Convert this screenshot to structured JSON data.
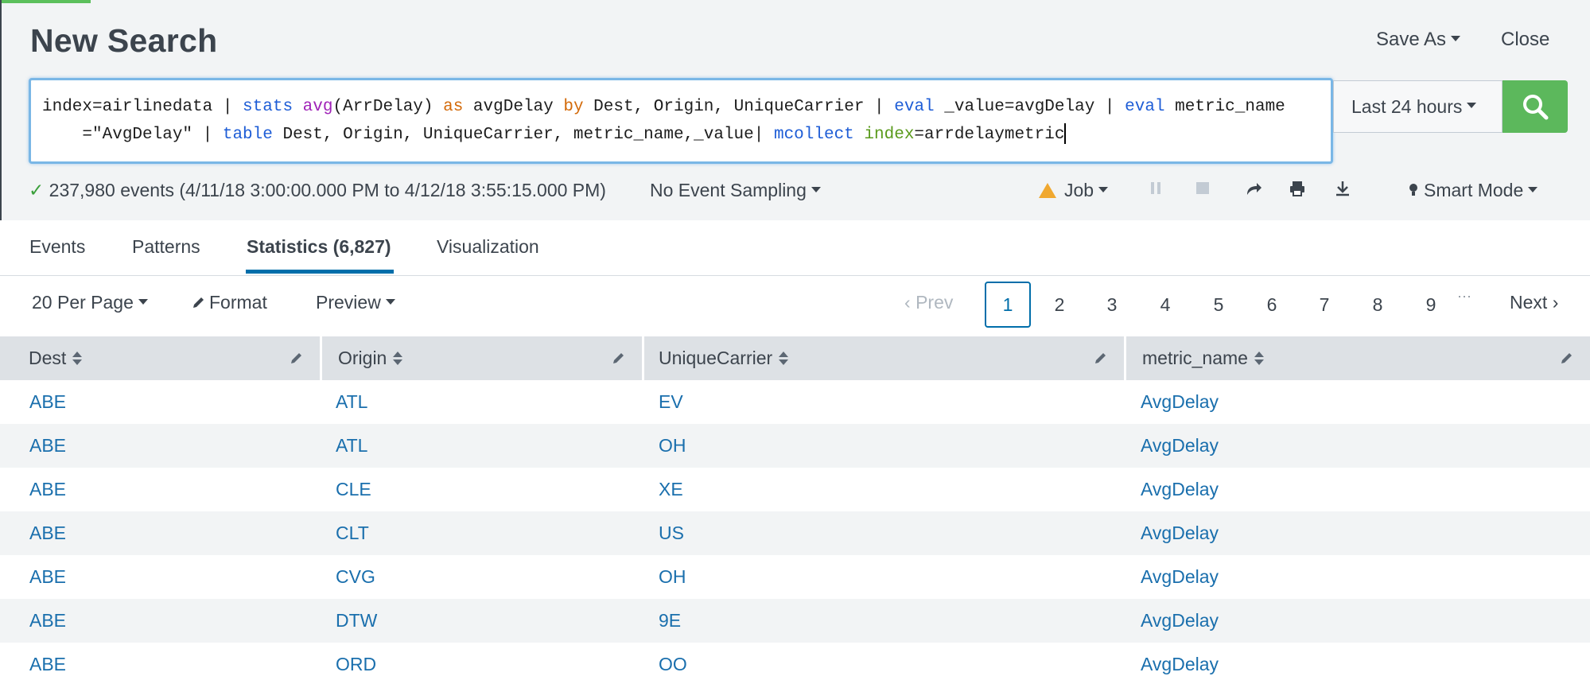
{
  "header": {
    "title": "New Search",
    "save_as": "Save As",
    "close": "Close"
  },
  "search": {
    "line1": {
      "p1": "index=airlinedata | ",
      "cmd_stats": "stats",
      "sp1": " ",
      "fn_avg": "avg",
      "p2": "(ArrDelay) ",
      "kw_as": "as",
      "p3": " avgDelay ",
      "kw_by": "by",
      "p4": " Dest, Origin, UniqueCarrier | ",
      "cmd_eval1": "eval",
      "p5": " _value=avgDelay | ",
      "cmd_eval2": "eval",
      "p6": " metric_name"
    },
    "line2": {
      "p1": "    =\"AvgDelay\" | ",
      "cmd_table": "table",
      "p2": " Dest, Origin, UniqueCarrier, metric_name,_value| ",
      "cmd_mcollect": "mcollect",
      "sp": " ",
      "arg_index": "index",
      "p3": "=arrdelaymetric"
    },
    "time_range": "Last 24 hours",
    "search_button_icon": "magnifier-icon"
  },
  "status": {
    "events": "237,980 events (4/11/18 3:00:00.000 PM to 4/12/18 3:55:15.000 PM)",
    "sampling": "No Event Sampling",
    "job": "Job",
    "mode": "Smart Mode"
  },
  "tabs": [
    {
      "label": "Events"
    },
    {
      "label": "Patterns"
    },
    {
      "label": "Statistics (6,827)"
    },
    {
      "label": "Visualization"
    }
  ],
  "toolbar": {
    "per_page": "20 Per Page",
    "format": "Format",
    "preview": "Preview"
  },
  "pager": {
    "prev": "Prev",
    "pages": [
      "1",
      "2",
      "3",
      "4",
      "5",
      "6",
      "7",
      "8",
      "9"
    ],
    "ellipsis": "···",
    "next": "Next"
  },
  "table": {
    "columns": [
      "Dest",
      "Origin",
      "UniqueCarrier",
      "metric_name"
    ],
    "rows": [
      [
        "ABE",
        "ATL",
        "EV",
        "AvgDelay"
      ],
      [
        "ABE",
        "ATL",
        "OH",
        "AvgDelay"
      ],
      [
        "ABE",
        "CLE",
        "XE",
        "AvgDelay"
      ],
      [
        "ABE",
        "CLT",
        "US",
        "AvgDelay"
      ],
      [
        "ABE",
        "CVG",
        "OH",
        "AvgDelay"
      ],
      [
        "ABE",
        "DTW",
        "9E",
        "AvgDelay"
      ],
      [
        "ABE",
        "ORD",
        "OO",
        "AvgDelay"
      ]
    ]
  },
  "colors": {
    "accent_green": "#5cb85c",
    "link_blue": "#1a6fad",
    "active_tab_underline": "#006eaa"
  }
}
